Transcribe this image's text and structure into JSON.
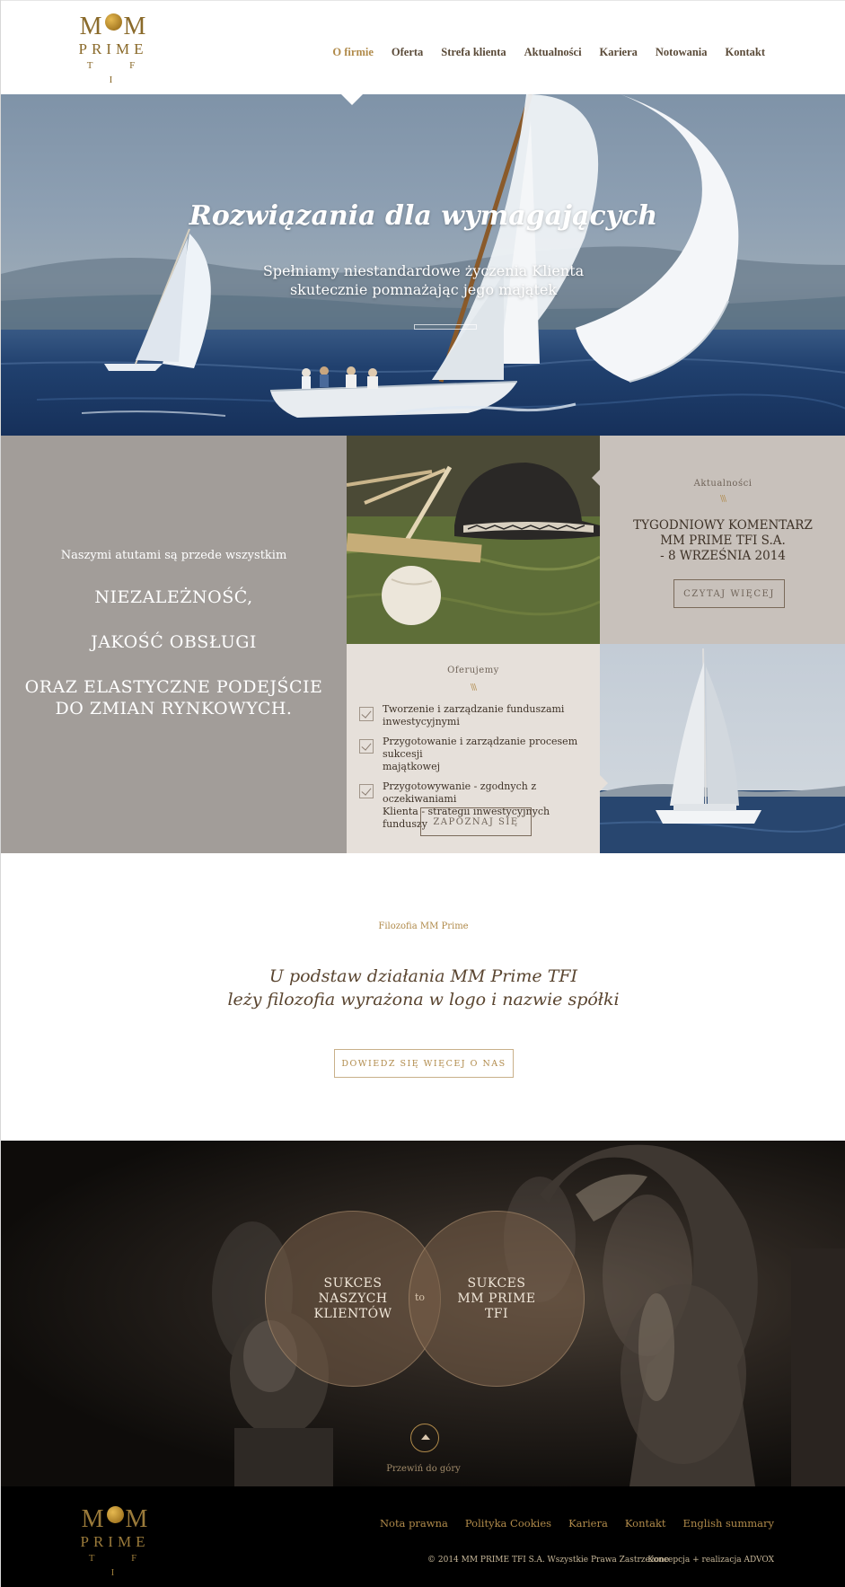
{
  "logo": {
    "mm_left": "M",
    "mm_right": "M",
    "prime": "PRIME",
    "tfi": "T F I"
  },
  "nav": [
    {
      "label": "O firmie",
      "active": true
    },
    {
      "label": "Oferta"
    },
    {
      "label": "Strefa klienta"
    },
    {
      "label": "Aktualności"
    },
    {
      "label": "Kariera"
    },
    {
      "label": "Notowania"
    },
    {
      "label": "Kontakt"
    }
  ],
  "hero": {
    "title": "Rozwiązania dla wymagających",
    "subtitle_line1": "Spełniamy niestandardowe życzenia Klienta",
    "subtitle_line2": "skutecznie pomnażając jego majątek"
  },
  "strengths": {
    "intro": "Naszymi atutami są przede wszystkim",
    "item1": "NIEZALEŻNOŚĆ,",
    "item2": "JAKOŚĆ OBSŁUGI",
    "item3_line1": "ORAZ ELASTYCZNE PODEJŚCIE",
    "item3_line2": "DO ZMIAN RYNKOWYCH."
  },
  "news": {
    "label": "Aktualności",
    "chevrons": "\\\\\\",
    "title_line1": "TYGODNIOWY KOMENTARZ",
    "title_line2": "MM PRIME TFI S.A.",
    "title_line3": "- 8 WRZEŚNIA 2014",
    "button": "CZYTAJ WIĘCEJ"
  },
  "offer": {
    "label": "Oferujemy",
    "chevrons": "\\\\\\",
    "items": [
      {
        "line1": "Tworzenie i zarządzanie funduszami",
        "line2": "inwestycyjnymi"
      },
      {
        "line1": "Przygotowanie i zarządzanie procesem sukcesji",
        "line2": "majątkowej"
      },
      {
        "line1": "Przygotowywanie - zgodnych z oczekiwaniami",
        "line2": "Klienta - strategii inwestycyjnych funduszy"
      }
    ],
    "button": "ZAPOZNAJ SIĘ"
  },
  "philosophy": {
    "label": "Filozofia MM Prime",
    "quote_line1": "U podstaw działania MM Prime TFI",
    "quote_line2": "leży filozofia wyrażona w logo i nazwie spółki",
    "button": "DOWIEDZ SIĘ WIĘCEJ O NAS"
  },
  "success": {
    "left_line1": "SUKCES",
    "left_line2": "NASZYCH",
    "left_line3": "KLIENTÓW",
    "connector": "to",
    "right_line1": "SUKCES",
    "right_line2": "MM PRIME",
    "right_line3": "TFI",
    "scroll_label": "Przewiń do góry"
  },
  "footer": {
    "links": [
      "Nota prawna",
      "Polityka Cookies",
      "Kariera",
      "Kontakt",
      "English summary"
    ],
    "copyright": "© 2014 MM PRIME TFI S.A. Wszystkie Prawa Zastrzeżone",
    "credit": "Koncepcja + realizacja ADVOX"
  },
  "colors": {
    "accent": "#b08a4a",
    "taupe": "#a29d99",
    "beige": "#e6e0da",
    "greige": "#c8c1bb",
    "footer": "#000000"
  }
}
